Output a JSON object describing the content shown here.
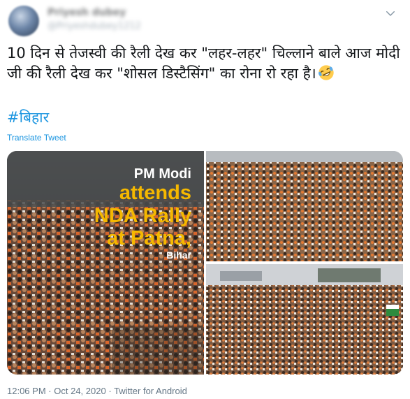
{
  "author": {
    "display_name": "Priyesh dubey",
    "handle": "@Priyeshdubey1212"
  },
  "tweet": {
    "text": "10 दिन से तेजस्वी की रैली देख कर \"लहर-लहर\" चिल्लाने बाले आज मोदी जी की रैली देख कर \"शोसल डिस्टैसिंग\" का रोना रो रहा है।",
    "emoji": "rolling-on-floor-laughing",
    "hashtag": "#बिहार",
    "translate_label": "Translate Tweet"
  },
  "media": {
    "left_overlay": {
      "line1": "PM Modi",
      "line2": "attends",
      "line3": "NDA Rally",
      "line4": "at Patna,",
      "line5": "Bihar"
    },
    "images": [
      "crowd-rally-left",
      "crowd-rally-top-right",
      "crowd-rally-bottom-right"
    ]
  },
  "footer": {
    "time": "12:06 PM",
    "separator": "·",
    "date": "Oct 24, 2020",
    "source": "Twitter for Android"
  },
  "colors": {
    "link": "#1b95e0",
    "text": "#14171a",
    "muted": "#657786",
    "overlay_yellow": "#f5b800"
  }
}
